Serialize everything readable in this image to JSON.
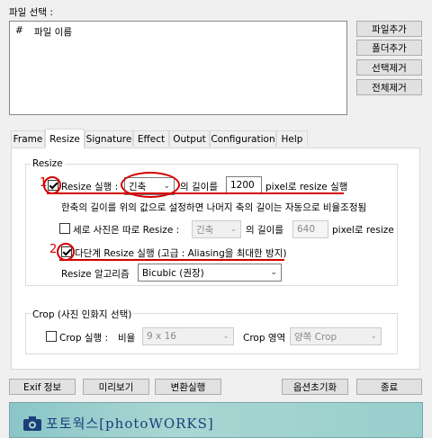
{
  "file_section": {
    "label": "파일 선택 :",
    "columns": [
      "#",
      "파일 이름"
    ]
  },
  "side_buttons": [
    "파일추가",
    "폴더추가",
    "선택제거",
    "전체제거"
  ],
  "tabs": [
    "Frame",
    "Resize",
    "Signature",
    "Effect",
    "Output",
    "Configuration",
    "Help"
  ],
  "active_tab": "Resize",
  "resize_group": {
    "title": "Resize",
    "row1": {
      "checkbox_label": "Resize 실행 :",
      "checked": true,
      "combo_value": "긴축",
      "mid_text": "의 길이를",
      "length_value": "1200",
      "suffix_text": "pixel로 resize 실행"
    },
    "note": "한축의 길이를 위의 값으로 설정하면 나머지 축의 길이는 자동으로 비율조정됨",
    "row2": {
      "checkbox_label": "세로 사진은 따로 Resize :",
      "checked": false,
      "combo_value": "긴축",
      "mid_text": "의 길이를",
      "length_value": "640",
      "suffix_text": "pixel로 resize"
    },
    "multistep": {
      "label": "다단계 Resize 실행 (고급 : Aliasing을 최대한 방지)",
      "checked": true
    },
    "algorithm": {
      "label": "Resize 알고리즘",
      "value": "Bicubic (권장)"
    }
  },
  "crop_group": {
    "title": "Crop (사진 인화지 선택)",
    "checkbox_label": "Crop 실행 :",
    "checked": false,
    "ratio_label": "비율",
    "ratio_value": "9 x 16",
    "area_label": "Crop 영역",
    "area_value": "양쪽 Crop"
  },
  "annotations": {
    "num1": "1",
    "num2": "2"
  },
  "bottom_buttons": {
    "exif": "Exif 정보",
    "preview": "미리보기",
    "convert": "변환실행",
    "reset": "옵션초기화",
    "exit": "종료"
  },
  "banner": {
    "text": "포토웍스[photoWORKS]"
  },
  "colors": {
    "annotation": "#d40000",
    "banner_text": "#1c3f7a"
  }
}
